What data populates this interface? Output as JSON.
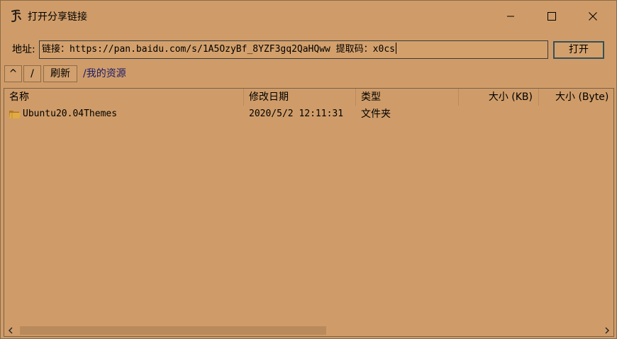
{
  "window": {
    "title": "打开分享链接"
  },
  "address": {
    "label": "地址:",
    "value": "链接：https://pan.baidu.com/s/1A5OzyBf_8YZF3gq2QaHQww 提取码：x0cs",
    "open_label": "打开"
  },
  "toolbar": {
    "up_label": "^",
    "root_label": "/",
    "refresh_label": "刷新",
    "path": "/我的资源"
  },
  "list": {
    "columns": [
      "名称",
      "修改日期",
      "类型",
      "大小 (KB)",
      "大小 (Byte)"
    ],
    "rows": [
      {
        "icon": "folder-icon",
        "name": "Ubuntu20.04Themes",
        "modified": "2020/5/2 12:11:31",
        "type": "文件夹",
        "size_kb": "",
        "size_byte": ""
      }
    ],
    "scroll_fraction": 0.53
  },
  "colors": {
    "background": "#cf9c69",
    "scroll_thumb": "#b98a5b",
    "folder": "#d9a441"
  }
}
